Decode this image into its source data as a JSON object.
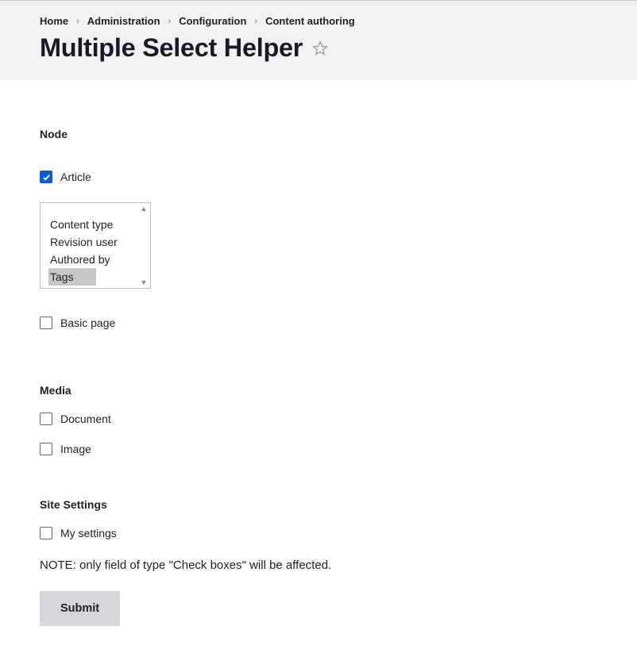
{
  "breadcrumbs": {
    "items": [
      "Home",
      "Administration",
      "Configuration",
      "Content authoring"
    ]
  },
  "page": {
    "title": "Multiple Select Helper"
  },
  "sections": {
    "node": {
      "heading": "Node",
      "items": {
        "article": {
          "label": "Article",
          "checked": true
        },
        "basic_page": {
          "label": "Basic page",
          "checked": false
        }
      },
      "listbox": {
        "options": [
          "Content type",
          "Revision user",
          "Authored by",
          "Tags"
        ],
        "selected": "Tags"
      }
    },
    "media": {
      "heading": "Media",
      "items": {
        "document": {
          "label": "Document",
          "checked": false
        },
        "image": {
          "label": "Image",
          "checked": false
        }
      }
    },
    "site_settings": {
      "heading": "Site Settings",
      "items": {
        "my_settings": {
          "label": "My settings",
          "checked": false
        }
      }
    }
  },
  "note": "NOTE: only field of type \"Check boxes\" will be affected.",
  "actions": {
    "submit_label": "Submit"
  }
}
